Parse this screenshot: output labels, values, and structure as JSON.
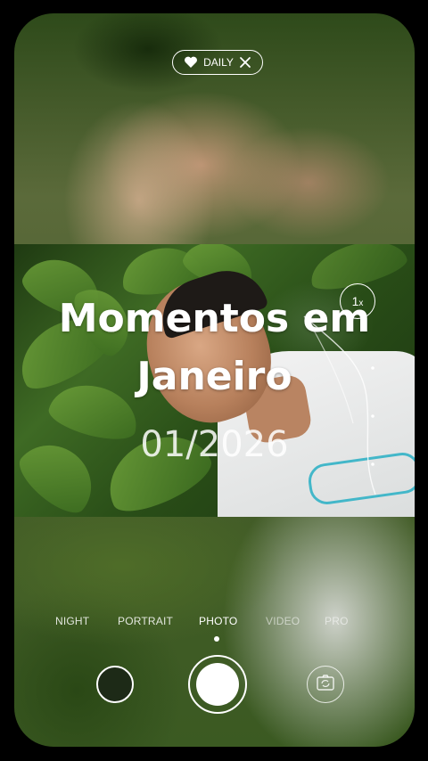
{
  "badge": {
    "label": "DAILY",
    "heart_icon": "heart-icon",
    "close_icon": "close-icon"
  },
  "overlay": {
    "title_line1": "Momentos em",
    "title_line2": "Janeiro",
    "date": "01/2026"
  },
  "zoom": {
    "value": "1",
    "unit": "x"
  },
  "camera_modes": {
    "items": [
      "NIGHT",
      "PORTRAIT",
      "PHOTO",
      "VIDEO",
      "PRO"
    ],
    "selected": "PHOTO"
  },
  "controls": {
    "gallery_icon": "gallery-thumbnail",
    "shutter_icon": "shutter-icon",
    "flip_icon": "flip-camera-icon"
  },
  "colors": {
    "background": "#000000",
    "text": "#ffffff",
    "shirt_print": "#43b7c9"
  }
}
